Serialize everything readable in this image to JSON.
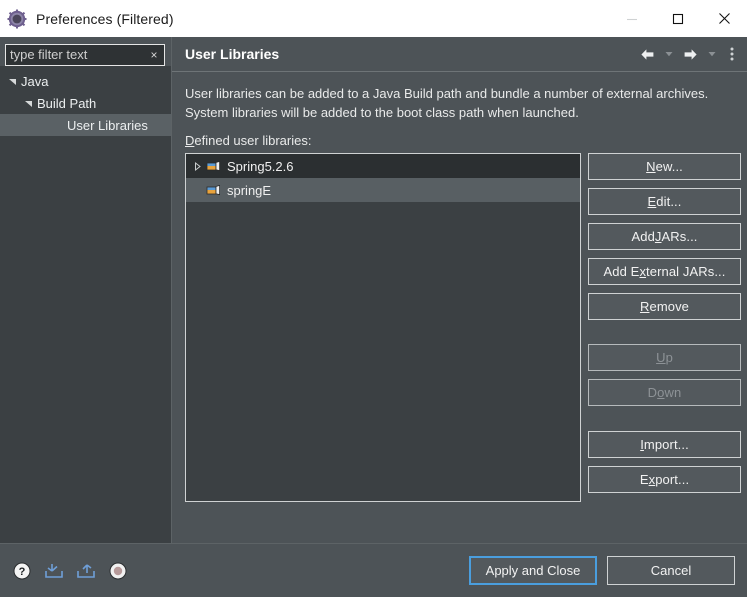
{
  "window": {
    "title": "Preferences (Filtered)",
    "icon": "preferences-gear-icon",
    "minimize_label": "Minimize",
    "maximize_label": "Maximize",
    "close_label": "Close"
  },
  "sidebar": {
    "filter": {
      "value": "type filter text",
      "placeholder": "type filter text",
      "clear_label": "×"
    },
    "tree": [
      {
        "label": "Java",
        "depth": 0,
        "twisty": "expanded",
        "selected": false
      },
      {
        "label": "Build Path",
        "depth": 1,
        "twisty": "expanded",
        "selected": false
      },
      {
        "label": "User Libraries",
        "depth": 2,
        "twisty": "none",
        "selected": true
      }
    ]
  },
  "page": {
    "title": "User Libraries",
    "toolbar": {
      "back": "back-icon",
      "back_menu": "back-dropdown-icon",
      "forward": "forward-icon",
      "forward_menu": "forward-dropdown-icon",
      "menu": "view-menu-icon"
    },
    "description": "User libraries can be added to a Java Build path and bundle a number of external archives. System libraries will be added to the boot class path when launched.",
    "list_label_prefix": "D",
    "list_label_rest": "efined user libraries:",
    "libraries": [
      {
        "name": "Spring5.2.6",
        "twisty": "collapsed",
        "selected": false
      },
      {
        "name": "springE",
        "twisty": "none",
        "selected": true
      }
    ],
    "buttons": [
      {
        "mnemonic": "N",
        "pre": "",
        "post": "ew...",
        "enabled": true,
        "gap": ""
      },
      {
        "mnemonic": "E",
        "pre": "",
        "post": "dit...",
        "enabled": true,
        "gap": ""
      },
      {
        "mnemonic": "J",
        "pre": "Add ",
        "post": "ARs...",
        "enabled": true,
        "gap": ""
      },
      {
        "mnemonic": "x",
        "pre": "Add E",
        "post": "ternal JARs...",
        "enabled": true,
        "gap": ""
      },
      {
        "mnemonic": "R",
        "pre": "",
        "post": "emove",
        "enabled": true,
        "gap": ""
      },
      {
        "mnemonic": "U",
        "pre": "",
        "post": "p",
        "enabled": false,
        "gap": "gap-top"
      },
      {
        "mnemonic": "o",
        "pre": "D",
        "post": "wn",
        "enabled": false,
        "gap": ""
      },
      {
        "mnemonic": "I",
        "pre": "",
        "post": "mport...",
        "enabled": true,
        "gap": "gap-top2"
      },
      {
        "mnemonic": "x",
        "pre": "E",
        "post": "port...",
        "enabled": true,
        "gap": ""
      }
    ]
  },
  "footer": {
    "icons": [
      {
        "name": "help-icon",
        "title": "Help"
      },
      {
        "name": "import-preferences-icon",
        "title": "Import"
      },
      {
        "name": "export-preferences-icon",
        "title": "Export"
      },
      {
        "name": "restore-defaults-icon",
        "title": "Restore Defaults"
      }
    ],
    "apply_and_close": "Apply and Close",
    "cancel": "Cancel"
  },
  "colors": {
    "window_bg": "#4d5357",
    "panel_bg": "#3b4043",
    "selection": "#585f63",
    "focus_border": "#4a9ede",
    "text": "#e8e8e8",
    "disabled_text": "#8d9296"
  }
}
